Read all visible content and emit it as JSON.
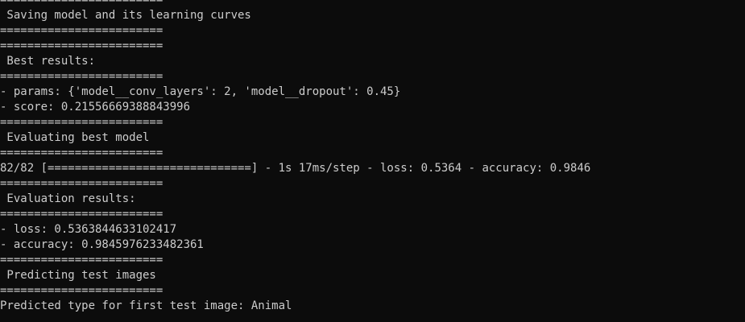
{
  "terminal": {
    "lines": [
      "========================",
      " Saving model and its learning curves",
      "========================",
      "========================",
      " Best results:",
      "========================",
      "- params: {'model__conv_layers': 2, 'model__dropout': 0.45}",
      "- score: 0.21556669388843996",
      "========================",
      " Evaluating best model",
      "========================",
      "82/82 [==============================] - 1s 17ms/step - loss: 0.5364 - accuracy: 0.9846",
      "========================",
      " Evaluation results:",
      "========================",
      "- loss: 0.5363844633102417",
      "- accuracy: 0.9845976233482361",
      "========================",
      " Predicting test images",
      "========================",
      "Predicted type for first test image: Animal"
    ]
  }
}
